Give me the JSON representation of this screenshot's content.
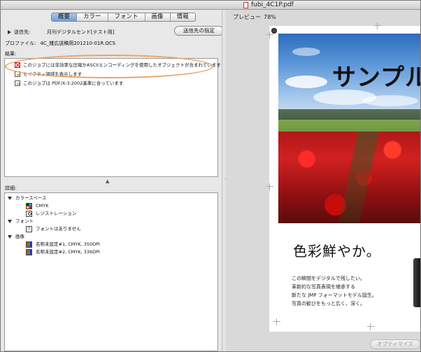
{
  "window": {
    "title": "fubi_4C1P.pdf"
  },
  "tabs": [
    "概要",
    "カラー",
    "フォント",
    "画像",
    "情報"
  ],
  "destination": {
    "label": "送信先:",
    "value": "月刊デジタルセンド[テスト用]",
    "button": "送信先の指定"
  },
  "profile": {
    "label": "プロファイル:",
    "value": "4C_雑広送稿用201210-01R.QCS"
  },
  "results": {
    "label": "結果:",
    "items": [
      "このジョブには非効率な圧縮かASCIIエンコーディングを使用したオブジェクトが含まれています",
      "セイフティ領域を表示します",
      "このジョブは PDF/X-3:2002基準に合っています"
    ]
  },
  "details": {
    "label": "詳細:",
    "colorspace": {
      "label": "カラースペース",
      "items": [
        "CMYK",
        "レジストレーション"
      ]
    },
    "font": {
      "label": "フォント",
      "items": [
        "フォントはありません"
      ]
    },
    "image": {
      "label": "画像",
      "items": [
        "名称未設定#1, CMYK, 350DPI",
        "名称未設定#2, CMYK, 336DPI"
      ]
    }
  },
  "preview": {
    "label": "プレビュー",
    "zoom": "78%",
    "headline": "サンプル",
    "copy_title": "色彩鮮やか。",
    "copy_lines": [
      "この瞬間をデジタルで残したい。",
      "革新的な写真表現を継承する",
      "新たな JMP フォーマットモデル誕生。",
      "写真の歓びをもっと広く、深く。"
    ]
  },
  "optimize_button": "オプティマイズ"
}
